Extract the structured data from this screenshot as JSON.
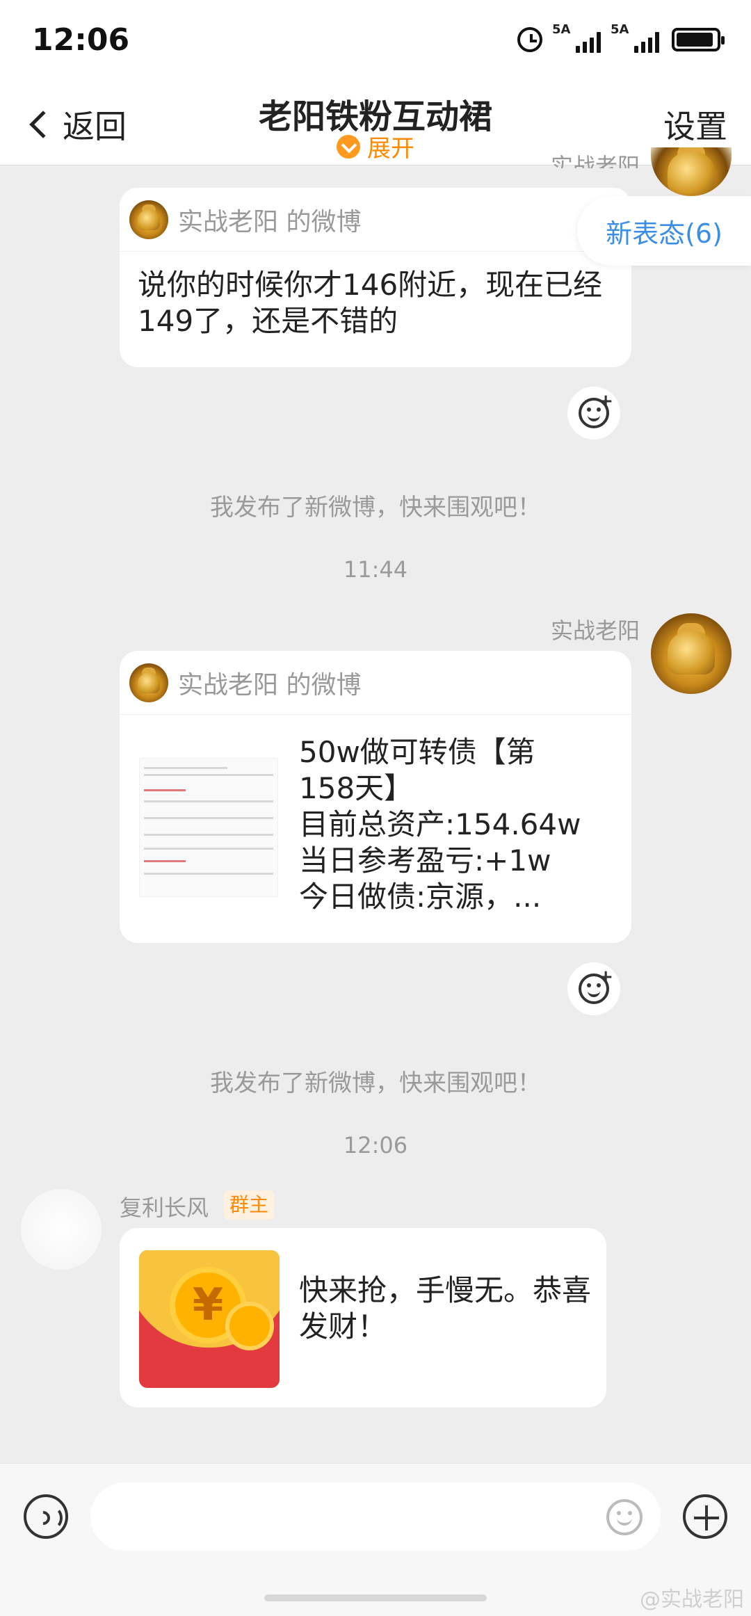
{
  "status_bar": {
    "time": "12:06",
    "sim1_label": "5A",
    "sim2_label": "5A",
    "icons": [
      "alarm-icon",
      "signal-icon",
      "signal-icon",
      "battery-icon"
    ]
  },
  "header": {
    "back_label": "返回",
    "title": "老阳铁粉互动裙",
    "expand_label": "展开",
    "settings_label": "设置"
  },
  "new_status": "新表态(6)",
  "messages": [
    {
      "type": "weibo",
      "sender": "实战老阳",
      "card_label": "实战老阳 的微博",
      "text": "说你的时候你才146附近，现在已经149了，还是不错的"
    },
    {
      "type": "system",
      "text": "我发布了新微博，快来围观吧！"
    },
    {
      "type": "time",
      "text": "11:44"
    },
    {
      "type": "weibo",
      "sender": "实战老阳",
      "card_label": "实战老阳 的微博",
      "text_lines": [
        "50w做可转债【第",
        "158天】",
        "目前总资产:154.64w",
        "当日参考盈亏:+1w",
        "今日做债:京源，..."
      ]
    },
    {
      "type": "system",
      "text": "我发布了新微博，快来围观吧！"
    },
    {
      "type": "time",
      "text": "12:06"
    },
    {
      "type": "red_packet",
      "sender": "复利长风",
      "badge": "群主",
      "text": "快来抢，手慢无。恭喜发财！"
    }
  ],
  "watermark": "@实战老阳",
  "colors": {
    "accent_orange": "#ff8a00",
    "link_blue": "#3a8ee6",
    "red_packet": "#e23a3f",
    "background": "#ededed"
  }
}
